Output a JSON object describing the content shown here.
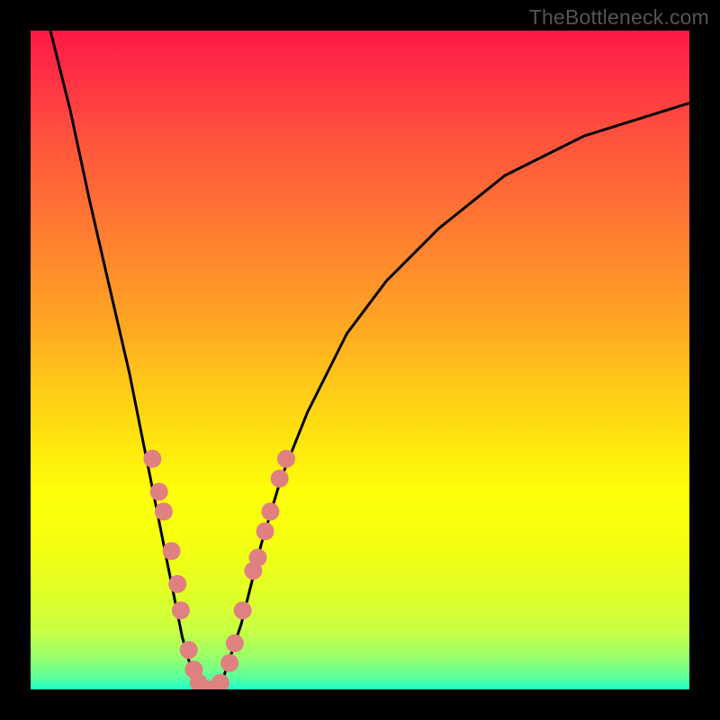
{
  "watermark": "TheBottleneck.com",
  "chart_data": {
    "type": "line",
    "title": "",
    "xlabel": "",
    "ylabel": "",
    "xlim": [
      0,
      100
    ],
    "ylim": [
      0,
      100
    ],
    "curve": [
      {
        "x": 3,
        "y": 100
      },
      {
        "x": 6,
        "y": 88
      },
      {
        "x": 9,
        "y": 74
      },
      {
        "x": 12,
        "y": 61
      },
      {
        "x": 15,
        "y": 48
      },
      {
        "x": 17,
        "y": 38
      },
      {
        "x": 19,
        "y": 28
      },
      {
        "x": 21,
        "y": 18
      },
      {
        "x": 23,
        "y": 8
      },
      {
        "x": 25,
        "y": 1
      },
      {
        "x": 27,
        "y": 0
      },
      {
        "x": 29,
        "y": 1
      },
      {
        "x": 32,
        "y": 10
      },
      {
        "x": 35,
        "y": 22
      },
      {
        "x": 38,
        "y": 32
      },
      {
        "x": 42,
        "y": 42
      },
      {
        "x": 48,
        "y": 54
      },
      {
        "x": 54,
        "y": 62
      },
      {
        "x": 62,
        "y": 70
      },
      {
        "x": 72,
        "y": 78
      },
      {
        "x": 84,
        "y": 84
      },
      {
        "x": 100,
        "y": 89
      }
    ],
    "markers": [
      {
        "x": 18.5,
        "y": 35
      },
      {
        "x": 19.5,
        "y": 30
      },
      {
        "x": 20.2,
        "y": 27
      },
      {
        "x": 21.4,
        "y": 21
      },
      {
        "x": 22.3,
        "y": 16
      },
      {
        "x": 22.8,
        "y": 12
      },
      {
        "x": 24.0,
        "y": 6
      },
      {
        "x": 24.8,
        "y": 3
      },
      {
        "x": 25.5,
        "y": 1
      },
      {
        "x": 26.5,
        "y": 0
      },
      {
        "x": 27.5,
        "y": 0
      },
      {
        "x": 28.8,
        "y": 1
      },
      {
        "x": 30.2,
        "y": 4
      },
      {
        "x": 31.0,
        "y": 7
      },
      {
        "x": 32.2,
        "y": 12
      },
      {
        "x": 33.8,
        "y": 18
      },
      {
        "x": 34.5,
        "y": 20
      },
      {
        "x": 35.6,
        "y": 24
      },
      {
        "x": 36.4,
        "y": 27
      },
      {
        "x": 37.8,
        "y": 32
      },
      {
        "x": 38.8,
        "y": 35
      }
    ],
    "marker_color": "#e08080",
    "curve_color": "#000000",
    "gradient_colors": {
      "top": "#ff1846",
      "mid": "#ffe40f",
      "bottom": "#1fffc8"
    }
  }
}
